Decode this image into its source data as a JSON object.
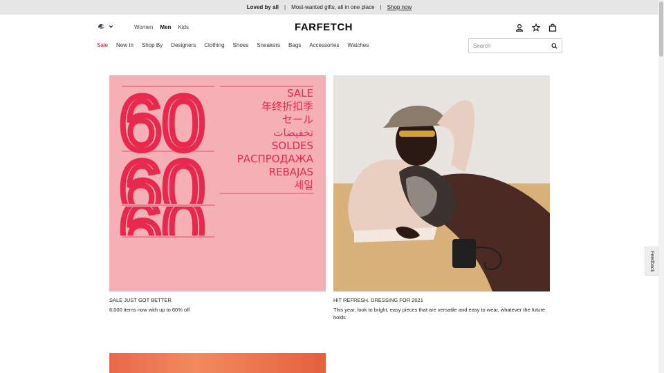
{
  "promo": {
    "bold": "Loved by all",
    "text": "Most-wanted gifts, all in one place",
    "link": "Shop now"
  },
  "header": {
    "logo": "FARFETCH",
    "gender_nav": [
      "Women",
      "Men",
      "Kids"
    ],
    "categories": [
      "Sale",
      "New In",
      "Shop By",
      "Designers",
      "Clothing",
      "Shoes",
      "Sneakers",
      "Bags",
      "Accessories",
      "Watches"
    ],
    "search_placeholder": "Search",
    "icons": [
      "user-icon",
      "star-icon",
      "bag-icon",
      "search-icon",
      "chevron-down-icon",
      "us-flag-icon"
    ]
  },
  "cards": [
    {
      "title": "SALE JUST GOT BETTER",
      "desc": "6,000 items now with up to 60% off",
      "image": {
        "numbers": [
          "60",
          "60",
          "60"
        ],
        "languages": [
          "SALE",
          "年终折扣季",
          "セール",
          "تخفيضات",
          "SOLDES",
          "РАСПРОДАЖА",
          "REBAJAS",
          "세일"
        ]
      }
    },
    {
      "title": "HIT REFRESH. DRESSING FOR 2021",
      "desc": "This year, look to bright, easy pieces that are versatile and easy to wear, whatever the future holds"
    }
  ],
  "feedback": "Feedback",
  "colors": {
    "sale_red": "#c8102e",
    "banner_pink": "#f4b0b5",
    "banner_text": "#e8284d"
  }
}
